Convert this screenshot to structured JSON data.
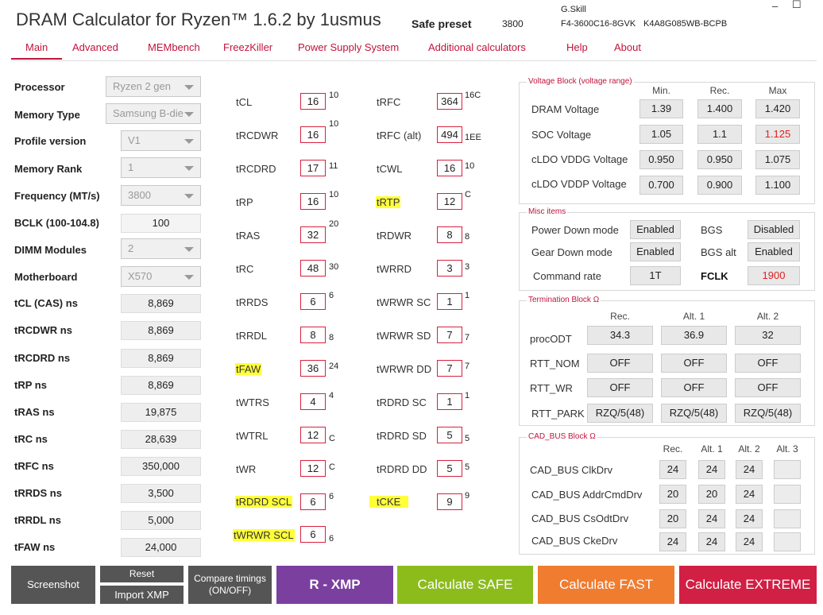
{
  "header": {
    "title": "DRAM Calculator for Ryzen™ 1.6.2 by 1usmus",
    "safe_preset_label": "Safe preset",
    "safe_preset_value": "3800",
    "mem_vendor": "G.Skill",
    "mem_part": "F4-3600C16-8GVK",
    "mem_ic": "K4A8G085WB-BCPB",
    "minimize": "–",
    "maximize": "☐"
  },
  "tabs": [
    "Main",
    "Advanced",
    "MEMbench",
    "FreezKiller",
    "Power Supply System",
    "Additional calculators",
    "Help",
    "About"
  ],
  "left": {
    "processor_label": "Processor",
    "processor": "Ryzen 2 gen",
    "memtype_label": "Memory Type",
    "memtype": "Samsung B-die",
    "profile_label": "Profile version",
    "profile": "V1",
    "rank_label": "Memory Rank",
    "rank": "1",
    "freq_label": "Frequency (MT/s)",
    "freq": "3800",
    "bclk_label": "BCLK (100-104.8)",
    "bclk": "100",
    "dimm_label": "DIMM Modules",
    "dimm": "2",
    "mb_label": "Motherboard",
    "mb": "X570",
    "ns": [
      {
        "label": "tCL (CAS) ns",
        "value": "8,869"
      },
      {
        "label": "tRCDWR ns",
        "value": "8,869"
      },
      {
        "label": "tRCDRD ns",
        "value": "8,869"
      },
      {
        "label": "tRP ns",
        "value": "8,869"
      },
      {
        "label": "tRAS ns",
        "value": "19,875"
      },
      {
        "label": "tRC ns",
        "value": "28,639"
      },
      {
        "label": "tRFC ns",
        "value": "350,000"
      },
      {
        "label": "tRRDS ns",
        "value": "3,500"
      },
      {
        "label": "tRRDL ns",
        "value": "5,000"
      },
      {
        "label": "tFAW ns",
        "value": "24,000"
      }
    ]
  },
  "timings_left": [
    {
      "name": "tCL",
      "value": "16",
      "hex": "10"
    },
    {
      "name": "tRCDWR",
      "value": "16",
      "hex": "10"
    },
    {
      "name": "tRCDRD",
      "value": "17",
      "hex": "11"
    },
    {
      "name": "tRP",
      "value": "16",
      "hex": "10"
    },
    {
      "name": "tRAS",
      "value": "32",
      "hex": "20"
    },
    {
      "name": "tRC",
      "value": "48",
      "hex": "30"
    },
    {
      "name": "tRRDS",
      "value": "6",
      "hex": "6"
    },
    {
      "name": "tRRDL",
      "value": "8",
      "hex": "8"
    },
    {
      "name": "tFAW",
      "value": "36",
      "hex": "24"
    },
    {
      "name": "tWTRS",
      "value": "4",
      "hex": "4"
    },
    {
      "name": "tWTRL",
      "value": "12",
      "hex": "C"
    },
    {
      "name": "tWR",
      "value": "12",
      "hex": "C"
    },
    {
      "name": "tRDRD SCL",
      "value": "6",
      "hex": "6"
    },
    {
      "name": "tWRWR SCL",
      "value": "6",
      "hex": "6"
    }
  ],
  "timings_right": [
    {
      "name": "tRFC",
      "value": "364",
      "hex": "16C"
    },
    {
      "name": "tRFC (alt)",
      "value": "494",
      "hex": "1EE"
    },
    {
      "name": "tCWL",
      "value": "16",
      "hex": "10"
    },
    {
      "name": "tRTP",
      "value": "12",
      "hex": "C"
    },
    {
      "name": "tRDWR",
      "value": "8",
      "hex": "8"
    },
    {
      "name": "tWRRD",
      "value": "3",
      "hex": "3"
    },
    {
      "name": "tWRWR SC",
      "value": "1",
      "hex": "1"
    },
    {
      "name": "tWRWR SD",
      "value": "7",
      "hex": "7"
    },
    {
      "name": "tWRWR DD",
      "value": "7",
      "hex": "7"
    },
    {
      "name": "tRDRD SC",
      "value": "1",
      "hex": "1"
    },
    {
      "name": "tRDRD SD",
      "value": "5",
      "hex": "5"
    },
    {
      "name": "tRDRD DD",
      "value": "5",
      "hex": "5"
    },
    {
      "name": "tCKE",
      "value": "9",
      "hex": "9"
    }
  ],
  "voltage": {
    "title": "Voltage Block (voltage range)",
    "headers": [
      "Min.",
      "Rec.",
      "Max"
    ],
    "rows": [
      {
        "label": "DRAM Voltage",
        "min": "1.39",
        "rec": "1.400",
        "max": "1.420"
      },
      {
        "label": "SOC Voltage",
        "min": "1.05",
        "rec": "1.1",
        "max": "1.125"
      },
      {
        "label": "cLDO VDDG Voltage",
        "min": "0.950",
        "rec": "0.950",
        "max": "1.075"
      },
      {
        "label": "cLDO VDDP Voltage",
        "min": "0.700",
        "rec": "0.900",
        "max": "1.100"
      }
    ]
  },
  "misc": {
    "title": "Misc items",
    "pdm_label": "Power Down mode",
    "pdm": "Enabled",
    "bgs_label": "BGS",
    "bgs": "Disabled",
    "gdm_label": "Gear Down mode",
    "gdm": "Enabled",
    "bgsalt_label": "BGS alt",
    "bgsalt": "Enabled",
    "cr_label": "Command rate",
    "cr": "1T",
    "fclk_label": "FCLK",
    "fclk": "1900"
  },
  "termination": {
    "title": "Termination Block Ω",
    "headers": [
      "Rec.",
      "Alt. 1",
      "Alt. 2"
    ],
    "rows": [
      {
        "label": "procODT",
        "vals": [
          "34.3",
          "36.9",
          "32"
        ]
      },
      {
        "label": "RTT_NOM",
        "vals": [
          "OFF",
          "OFF",
          "OFF"
        ]
      },
      {
        "label": "RTT_WR",
        "vals": [
          "OFF",
          "OFF",
          "OFF"
        ]
      },
      {
        "label": "RTT_PARK",
        "vals": [
          "RZQ/5(48)",
          "RZQ/5(48)",
          "RZQ/5(48)"
        ]
      }
    ]
  },
  "cadbus": {
    "title": "CAD_BUS Block Ω",
    "headers": [
      "Rec.",
      "Alt. 1",
      "Alt. 2",
      "Alt. 3"
    ],
    "rows": [
      {
        "label": "CAD_BUS ClkDrv",
        "vals": [
          "24",
          "24",
          "24",
          ""
        ]
      },
      {
        "label": "CAD_BUS AddrCmdDrv",
        "vals": [
          "20",
          "20",
          "24",
          ""
        ]
      },
      {
        "label": "CAD_BUS CsOdtDrv",
        "vals": [
          "20",
          "24",
          "24",
          ""
        ]
      },
      {
        "label": "CAD_BUS CkeDrv",
        "vals": [
          "24",
          "24",
          "24",
          ""
        ]
      }
    ]
  },
  "buttons": {
    "screenshot": "Screenshot",
    "reset": "Reset",
    "import_xmp": "Import XMP",
    "compare": "Compare timings (ON/OFF)",
    "rxmp": "R - XMP",
    "safe": "Calculate SAFE",
    "fast": "Calculate FAST",
    "extreme": "Calculate EXTREME"
  },
  "colors": {
    "accent": "#c0143c",
    "rxmp": "#7b3fa0",
    "safe": "#8cbc1c",
    "fast": "#f07c30",
    "extreme": "#d21f44",
    "dark": "#555555"
  }
}
